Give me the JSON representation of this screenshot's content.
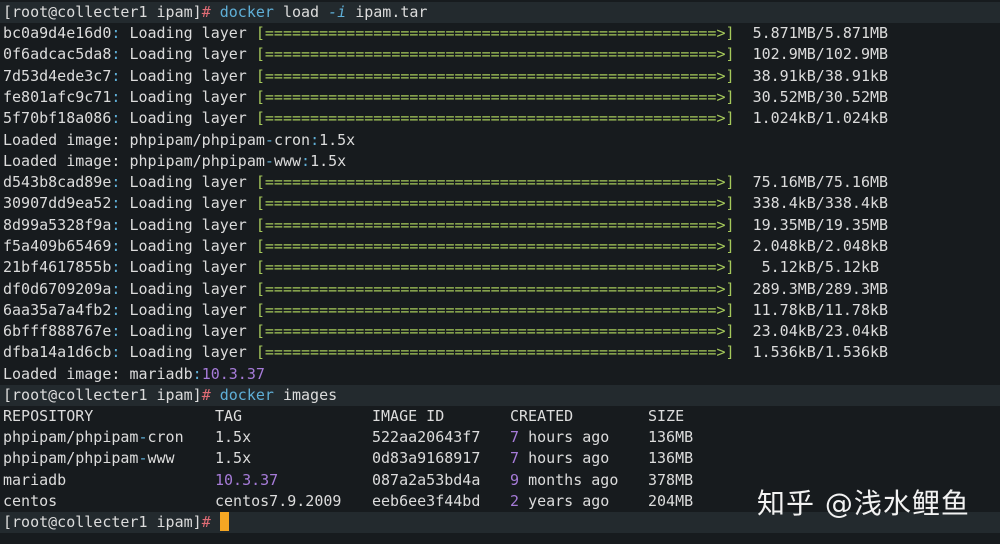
{
  "terminal": {
    "prompt": "[root@collecter1 ipam]",
    "prompt_hash": "#",
    "command1": {
      "cmd": "docker",
      "sub": "load",
      "flag": "-i",
      "arg": "ipam.tar"
    },
    "layers_a": [
      {
        "id": "bc0a9d4e16d0",
        "size": "5.871MB/5.871MB"
      },
      {
        "id": "0f6adcac5da8",
        "size": "102.9MB/102.9MB"
      },
      {
        "id": "7d53d4ede3c7",
        "size": "38.91kB/38.91kB"
      },
      {
        "id": "fe801afc9c71",
        "size": "30.52MB/30.52MB"
      },
      {
        "id": "5f70bf18a086",
        "size": "1.024kB/1.024kB"
      }
    ],
    "loaded_label": "Loaded image:",
    "loaded_cron": {
      "pre": "phpipam/phpipam",
      "post": "cron",
      "tag": "1.5x"
    },
    "loaded_www": {
      "pre": "phpipam/phpipam",
      "post": "www",
      "tag": "1.5x"
    },
    "layers_b": [
      {
        "id": "d543b8cad89e",
        "size": "75.16MB/75.16MB"
      },
      {
        "id": "30907dd9ea52",
        "size": "338.4kB/338.4kB"
      },
      {
        "id": "8d99a5328f9a",
        "size": "19.35MB/19.35MB"
      },
      {
        "id": "f5a409b65469",
        "size": "2.048kB/2.048kB"
      },
      {
        "id": "21bf4617855b",
        "size": " 5.12kB/5.12kB"
      },
      {
        "id": "df0d6709209a",
        "size": "289.3MB/289.3MB"
      },
      {
        "id": "6aa35a7a4fb2",
        "size": "11.78kB/11.78kB"
      },
      {
        "id": "6bfff888767e",
        "size": "23.04kB/23.04kB"
      },
      {
        "id": "dfba14a1d6cb",
        "size": "1.536kB/1.536kB"
      }
    ],
    "loading_text": "Loading layer",
    "progress_bar": "[==================================================>]",
    "loaded_mariadb": {
      "name": "mariadb",
      "tag": "10.3.37"
    },
    "command2": {
      "cmd": "docker",
      "sub": "images"
    },
    "images_table": {
      "headers": [
        "REPOSITORY",
        "TAG",
        "IMAGE ID",
        "CREATED",
        "SIZE"
      ],
      "rows": [
        {
          "repo": "phpipam/phpipam-cron",
          "tag": "1.5x",
          "id": "522aa20643f7",
          "created_num": "7",
          "created_rest": "hours ago",
          "size": "136MB"
        },
        {
          "repo": "phpipam/phpipam-www",
          "tag": "1.5x",
          "id": "0d83a9168917",
          "created_num": "7",
          "created_rest": "hours ago",
          "size": "136MB"
        },
        {
          "repo": "mariadb",
          "tag": "10.3.37",
          "id": "087a2a53bd4a",
          "created_num": "9",
          "created_rest": "months ago",
          "size": "378MB"
        },
        {
          "repo": "centos",
          "tag": "centos7.9.2009",
          "id": "eeb6ee3f44bd",
          "created_num": "2",
          "created_rest": "years ago",
          "size": "204MB"
        }
      ]
    }
  },
  "watermark": "知乎 @浅水鲤鱼",
  "colors": {
    "background": "#171b1e",
    "highlight_row": "#232a2e",
    "text": "#dcdcdc",
    "command": "#5fafd7",
    "hash": "#e06c75",
    "progress": "#a6c95b",
    "number": "#a67bd8",
    "cursor": "#f5a623"
  }
}
